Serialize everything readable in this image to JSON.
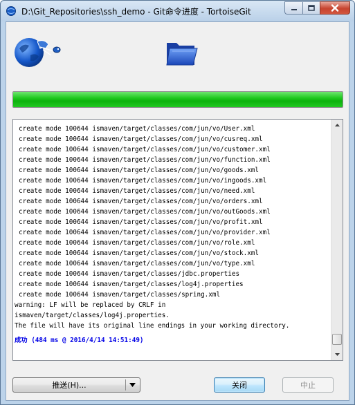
{
  "window": {
    "title": "D:\\Git_Repositories\\ssh_demo - Git命令进度 - TortoiseGit"
  },
  "progress": {
    "percent": 100,
    "color": "#19c419"
  },
  "log": {
    "lines": [
      {
        "text": "create mode 100644 ismaven/target/classes/com/jun/vo/User.xml",
        "indent": true
      },
      {
        "text": "create mode 100644 ismaven/target/classes/com/jun/vo/cusreq.xml",
        "indent": true
      },
      {
        "text": "create mode 100644 ismaven/target/classes/com/jun/vo/customer.xml",
        "indent": true
      },
      {
        "text": "create mode 100644 ismaven/target/classes/com/jun/vo/function.xml",
        "indent": true
      },
      {
        "text": "create mode 100644 ismaven/target/classes/com/jun/vo/goods.xml",
        "indent": true
      },
      {
        "text": "create mode 100644 ismaven/target/classes/com/jun/vo/ingoods.xml",
        "indent": true
      },
      {
        "text": "create mode 100644 ismaven/target/classes/com/jun/vo/need.xml",
        "indent": true
      },
      {
        "text": "create mode 100644 ismaven/target/classes/com/jun/vo/orders.xml",
        "indent": true
      },
      {
        "text": "create mode 100644 ismaven/target/classes/com/jun/vo/outGoods.xml",
        "indent": true
      },
      {
        "text": "create mode 100644 ismaven/target/classes/com/jun/vo/profit.xml",
        "indent": true
      },
      {
        "text": "create mode 100644 ismaven/target/classes/com/jun/vo/provider.xml",
        "indent": true
      },
      {
        "text": "create mode 100644 ismaven/target/classes/com/jun/vo/role.xml",
        "indent": true
      },
      {
        "text": "create mode 100644 ismaven/target/classes/com/jun/vo/stock.xml",
        "indent": true
      },
      {
        "text": "create mode 100644 ismaven/target/classes/com/jun/vo/type.xml",
        "indent": true
      },
      {
        "text": "create mode 100644 ismaven/target/classes/jdbc.properties",
        "indent": true
      },
      {
        "text": "create mode 100644 ismaven/target/classes/log4j.properties",
        "indent": true
      },
      {
        "text": "create mode 100644 ismaven/target/classes/spring.xml",
        "indent": true
      },
      {
        "text": "warning: LF will be replaced by CRLF in",
        "indent": false
      },
      {
        "text": "ismaven/target/classes/log4j.properties.",
        "indent": false
      },
      {
        "text": "The file will have its original line endings in your working directory.",
        "indent": false
      }
    ],
    "success": "成功 (484 ms @ 2016/4/14 14:51:49)",
    "success_color": "#0000e6"
  },
  "buttons": {
    "push": "推送(H)...",
    "close": "关闭",
    "abort": "中止"
  },
  "icons": {
    "app": "tortoisegit-icon",
    "logo": "tortoisegit-globe-logo",
    "folder": "folder-icon",
    "dropdown": "chevron-down-icon"
  }
}
